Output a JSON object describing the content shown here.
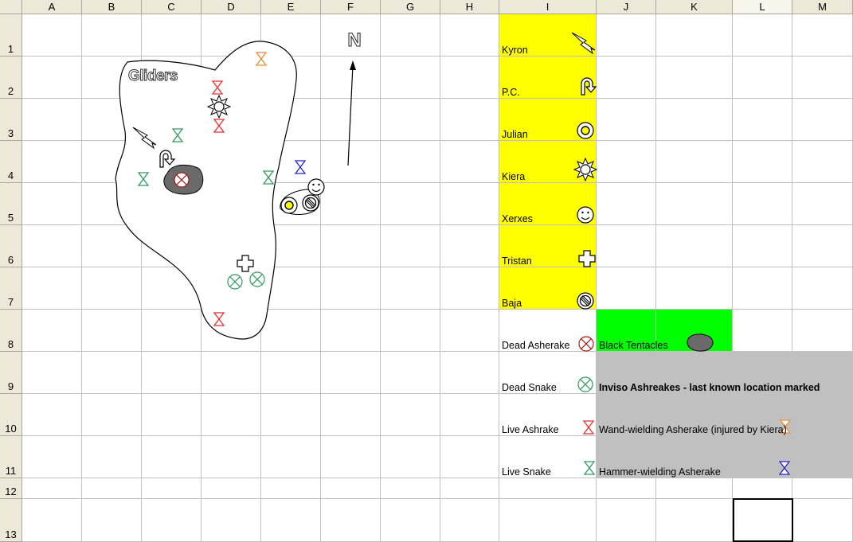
{
  "columns": [
    "A",
    "B",
    "C",
    "D",
    "E",
    "F",
    "G",
    "H",
    "I",
    "J",
    "K",
    "L",
    "M"
  ],
  "rows": [
    "1",
    "2",
    "3",
    "4",
    "5",
    "6",
    "7",
    "8",
    "9",
    "10",
    "11",
    "12",
    "13"
  ],
  "map": {
    "island_label": "Gliders",
    "north_label": "N"
  },
  "legend": {
    "party": [
      {
        "name": "Kyron",
        "icon": "lightning-icon"
      },
      {
        "name": "P.C.",
        "icon": "curved-arrow-icon"
      },
      {
        "name": "Julian",
        "icon": "ring-icon"
      },
      {
        "name": "Kiera",
        "icon": "sun-icon"
      },
      {
        "name": "Xerxes",
        "icon": "smiley-icon"
      },
      {
        "name": "Tristan",
        "icon": "cross-icon"
      },
      {
        "name": "Baja",
        "icon": "no-symbol-icon"
      }
    ],
    "markers": [
      {
        "name": "Dead Asherake",
        "icon": "crossed-circle-red-icon"
      },
      {
        "name": "Dead Snake",
        "icon": "crossed-circle-green-icon"
      },
      {
        "name": "Live Ashrake",
        "icon": "hourglass-red-icon"
      },
      {
        "name": "Live Snake",
        "icon": "hourglass-green-icon"
      }
    ],
    "black_tentacles": "Black Tentacles",
    "inviso_title": "Inviso Ashreakes - last known location marked",
    "wand_label": "Wand-wielding Asherake (injured by Kiera)",
    "hammer_label": "Hammer-wielding Asherake"
  },
  "colors": {
    "party_bg": "#ffff00",
    "tentacles_bg": "#00ff00",
    "inviso_bg": "#c0c0c0",
    "asherake": "#e83030",
    "snake": "#2e9a60",
    "wand": "#f08a30",
    "hammer": "#2424d0"
  }
}
